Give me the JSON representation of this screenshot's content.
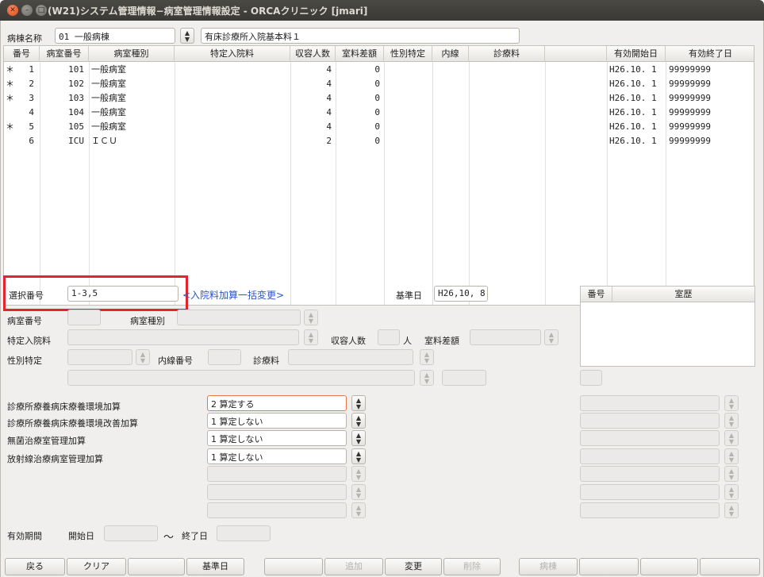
{
  "window": {
    "title": "(W21)システム管理情報−病室管理情報設定 - ORCAクリニック [jmari]"
  },
  "ward": {
    "label": "病棟名称",
    "value": "01 一般病棟",
    "name": "有床診療所入院基本料１"
  },
  "table": {
    "columns": [
      "番号",
      "病室番号",
      "病室種別",
      "特定入院料",
      "収容人数",
      "室料差額",
      "性別特定",
      "内線",
      "診療料",
      "有効開始日",
      "有効終了日"
    ],
    "rows": [
      {
        "mark": "＊",
        "no": "1",
        "room": "101",
        "type": "一般病室",
        "special": "",
        "capacity": "4",
        "diff": "0",
        "sex": "",
        "ext": "",
        "fee": "",
        "start": "H26.10. 1",
        "end": "99999999"
      },
      {
        "mark": "＊",
        "no": "2",
        "room": "102",
        "type": "一般病室",
        "special": "",
        "capacity": "4",
        "diff": "0",
        "sex": "",
        "ext": "",
        "fee": "",
        "start": "H26.10. 1",
        "end": "99999999"
      },
      {
        "mark": "＊",
        "no": "3",
        "room": "103",
        "type": "一般病室",
        "special": "",
        "capacity": "4",
        "diff": "0",
        "sex": "",
        "ext": "",
        "fee": "",
        "start": "H26.10. 1",
        "end": "99999999"
      },
      {
        "mark": "",
        "no": "4",
        "room": "104",
        "type": "一般病室",
        "special": "",
        "capacity": "4",
        "diff": "0",
        "sex": "",
        "ext": "",
        "fee": "",
        "start": "H26.10. 1",
        "end": "99999999"
      },
      {
        "mark": "＊",
        "no": "5",
        "room": "105",
        "type": "一般病室",
        "special": "",
        "capacity": "4",
        "diff": "0",
        "sex": "",
        "ext": "",
        "fee": "",
        "start": "H26.10. 1",
        "end": "99999999"
      },
      {
        "mark": "",
        "no": "6",
        "room": "ICU",
        "type": "ＩＣＵ",
        "special": "",
        "capacity": "2",
        "diff": "0",
        "sex": "",
        "ext": "",
        "fee": "",
        "start": "H26.10. 1",
        "end": "99999999"
      }
    ]
  },
  "selection": {
    "label": "選択番号",
    "value": "1-3,5",
    "bulk_link": "<入院料加算一括変更>",
    "base_date_label": "基準日",
    "base_date": "H26,10, 8"
  },
  "history": {
    "col_no": "番号",
    "col_history": "室歴"
  },
  "details": {
    "room_no": "病室番号",
    "room_type": "病室種別",
    "special_fee": "特定入院料",
    "capacity": "収容人数",
    "capacity_unit": "人",
    "room_diff": "室料差額",
    "sex": "性別特定",
    "extension": "内線番号",
    "medical_fee": "診療料"
  },
  "additions": [
    {
      "label": "診療所療養病床療養環境加算",
      "value": "2 算定する"
    },
    {
      "label": "診療所療養病床療養環境改善加算",
      "value": "1 算定しない"
    },
    {
      "label": "無菌治療室管理加算",
      "value": "1 算定しない"
    },
    {
      "label": "放射線治療病室管理加算",
      "value": "1 算定しない"
    }
  ],
  "period": {
    "label": "有効期間",
    "start_label": "開始日",
    "tilde": "〜",
    "end_label": "終了日"
  },
  "buttons": {
    "back": "戻る",
    "clear": "クリア",
    "base_date": "基準日",
    "add": "追加",
    "change": "変更",
    "delete": "削除",
    "ward": "病棟"
  },
  "colors": {
    "highlight": "#e3242b",
    "link": "#2a55c9",
    "focus": "#e07a4a"
  }
}
